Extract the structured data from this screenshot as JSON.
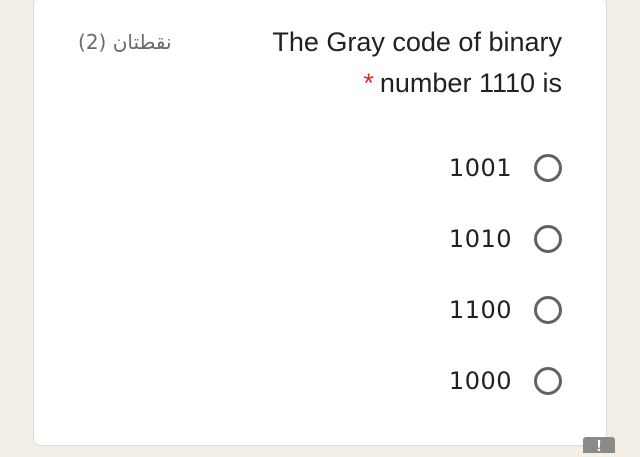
{
  "question": {
    "points": "نقطتان (2)",
    "title_line1": "The Gray code of binary",
    "required_mark": "*",
    "title_line2": "number 1110 is"
  },
  "options": [
    {
      "label": "1001",
      "selected": false
    },
    {
      "label": "1010",
      "selected": false
    },
    {
      "label": "1100",
      "selected": false
    },
    {
      "label": "1000",
      "selected": false
    }
  ],
  "report_button": {
    "icon": "exclamation-icon",
    "glyph": "!"
  },
  "colors": {
    "required": "#d93025",
    "radio_border": "#5f6368",
    "background": "#f3efe6"
  }
}
